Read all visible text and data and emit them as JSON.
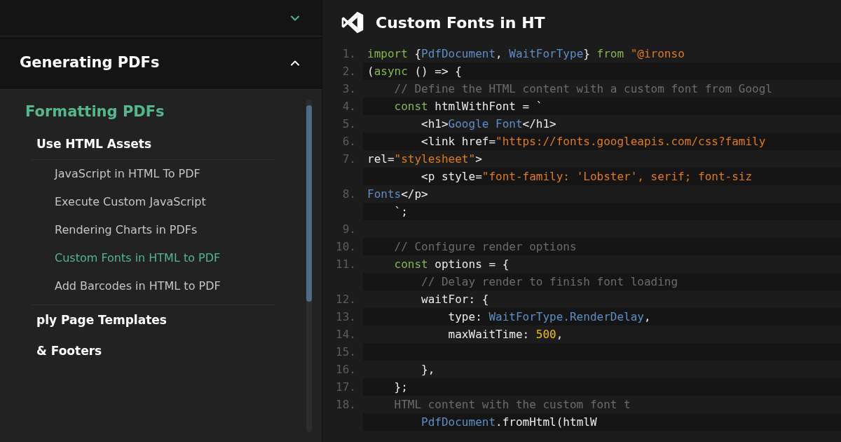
{
  "sidebar": {
    "sections": [
      {
        "expanded": false
      },
      {
        "title": "Generating PDFs",
        "expanded": true,
        "groups": [
          {
            "title": "Formatting PDFs",
            "selected": true,
            "children": [
              {
                "title": "Use HTML Assets",
                "selected": false,
                "children": [
                  {
                    "title": "JavaScript in HTML To PDF",
                    "selected": false
                  },
                  {
                    "title": "Execute Custom JavaScript",
                    "selected": false
                  },
                  {
                    "title": "Rendering Charts in PDFs",
                    "selected": false
                  },
                  {
                    "title": "Custom Fonts in HTML to PDF",
                    "selected": true
                  },
                  {
                    "title": "Add Barcodes in HTML to PDF",
                    "selected": false
                  }
                ]
              },
              {
                "title": "ply Page Templates",
                "selected": false
              },
              {
                "title": "& Footers",
                "selected": false
              }
            ]
          }
        ]
      }
    ]
  },
  "editor": {
    "title": "Custom Fonts in HT",
    "lines": [
      {
        "number": "1.",
        "tokens": [
          {
            "kind": "keyword",
            "text": "import"
          },
          {
            "kind": "plain",
            "text": " {"
          },
          {
            "kind": "type",
            "text": "PdfDocument"
          },
          {
            "kind": "plain",
            "text": ", "
          },
          {
            "kind": "type",
            "text": "WaitForType"
          },
          {
            "kind": "plain",
            "text": "} "
          },
          {
            "kind": "keyword",
            "text": "from"
          },
          {
            "kind": "string",
            "text": " \"@ironso"
          }
        ]
      },
      {
        "number": "2.",
        "tokens": [
          {
            "kind": "plain",
            "text": "("
          },
          {
            "kind": "keyword",
            "text": "async"
          },
          {
            "kind": "plain",
            "text": " () => {"
          }
        ]
      },
      {
        "number": "3.",
        "tokens": [
          {
            "kind": "comment",
            "text": "    // Define the HTML content with a custom font from Googl"
          }
        ]
      },
      {
        "number": "4.",
        "tokens": [
          {
            "kind": "keyword",
            "text": "    const"
          },
          {
            "kind": "plain",
            "text": " htmlWithFont = `"
          }
        ]
      },
      {
        "number": "5.",
        "tokens": [
          {
            "kind": "plain",
            "text": "        <h1>"
          },
          {
            "kind": "type",
            "text": "Google Font"
          },
          {
            "kind": "plain",
            "text": "</h1>"
          }
        ]
      },
      {
        "number": "6.",
        "tokens": [
          {
            "kind": "plain",
            "text": "        <link href="
          },
          {
            "kind": "string",
            "text": "\"https://fonts.googleapis.com/css?family"
          }
        ]
      },
      {
        "number": "7.",
        "tokens": [
          {
            "kind": "plain",
            "text": "rel="
          },
          {
            "kind": "string",
            "text": "\"stylesheet\""
          },
          {
            "kind": "plain",
            "text": ">"
          }
        ]
      },
      {
        "tokens": [
          {
            "kind": "plain",
            "text": "        <p style="
          },
          {
            "kind": "string",
            "text": "\"font-family: 'Lobster', serif; font-siz"
          }
        ]
      },
      {
        "number": "8.",
        "tokens": [
          {
            "kind": "type",
            "text": "Fonts"
          },
          {
            "kind": "plain",
            "text": "</p>"
          }
        ]
      },
      {
        "tokens": [
          {
            "kind": "plain",
            "text": "    `;"
          }
        ]
      },
      {
        "number": "9."
      },
      {
        "number": "10.",
        "tokens": [
          {
            "kind": "comment",
            "text": "    // Configure render options"
          }
        ]
      },
      {
        "number": "11.",
        "tokens": [
          {
            "kind": "keyword",
            "text": "    const"
          },
          {
            "kind": "plain",
            "text": " options = {"
          }
        ]
      },
      {
        "tokens": [
          {
            "kind": "comment",
            "text": "        // Delay render to finish font loading"
          }
        ]
      },
      {
        "number": "12.",
        "tokens": [
          {
            "kind": "plain",
            "text": "        waitFor: {"
          }
        ]
      },
      {
        "number": "13.",
        "tokens": [
          {
            "kind": "plain",
            "text": "            type: "
          },
          {
            "kind": "type",
            "text": "WaitForType.RenderDelay"
          },
          {
            "kind": "plain",
            "text": ","
          }
        ]
      },
      {
        "number": "14.",
        "tokens": [
          {
            "kind": "plain",
            "text": "            maxWaitTime: "
          },
          {
            "kind": "number",
            "text": "500"
          },
          {
            "kind": "plain",
            "text": ","
          }
        ]
      },
      {
        "number": "15."
      },
      {
        "number": "16.",
        "tokens": [
          {
            "kind": "plain",
            "text": "        },"
          }
        ]
      },
      {
        "number": "17.",
        "tokens": [
          {
            "kind": "plain",
            "text": "    };"
          }
        ]
      },
      {
        "number": "18.",
        "tokens": [
          {
            "kind": "comment",
            "text": "    HTML content with the custom font t"
          }
        ]
      },
      {
        "tokens": [
          {
            "kind": "type",
            "text": "        PdfDocument"
          },
          {
            "kind": "plain",
            "text": ".fromHtml(htmlW"
          }
        ]
      }
    ]
  }
}
